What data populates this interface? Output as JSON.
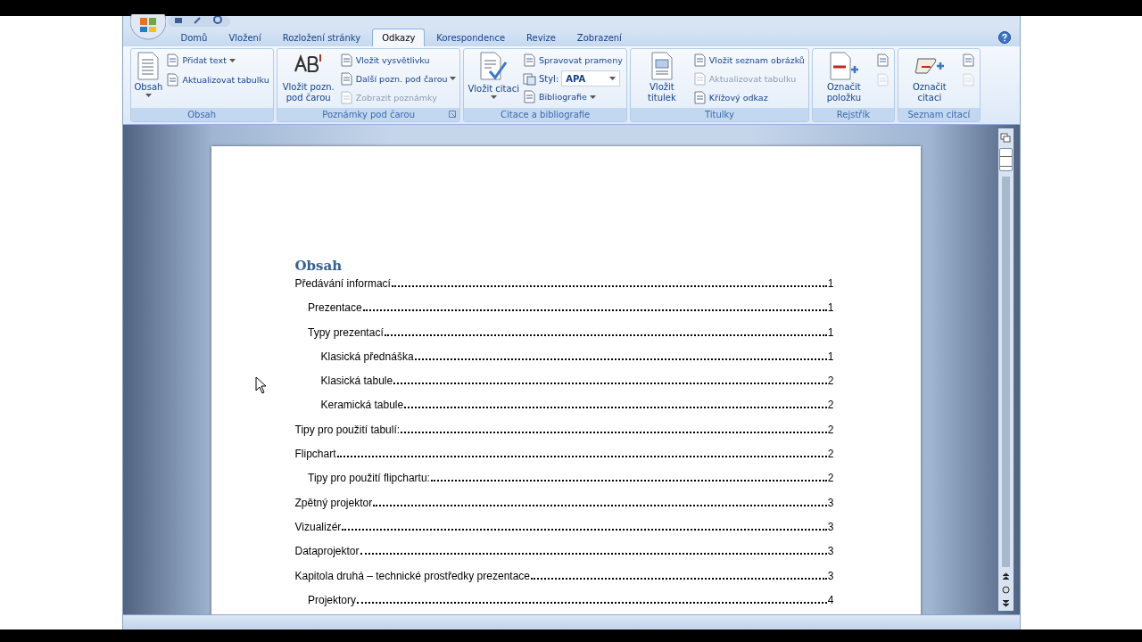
{
  "tabs": [
    {
      "label": "Domů",
      "selected": false
    },
    {
      "label": "Vložení",
      "selected": false
    },
    {
      "label": "Rozložení stránky",
      "selected": false
    },
    {
      "label": "Odkazy",
      "selected": true
    },
    {
      "label": "Korespondence",
      "selected": false
    },
    {
      "label": "Revize",
      "selected": false
    },
    {
      "label": "Zobrazení",
      "selected": false
    }
  ],
  "ribbon_groups": [
    {
      "label": "Obsah",
      "launcher": false,
      "items": [
        {
          "kind": "large",
          "label": "Obsah",
          "dropdown": true,
          "disabled": false
        },
        {
          "kind": "small",
          "label": "Přidat text",
          "dropdown": true,
          "disabled": false
        },
        {
          "kind": "small",
          "label": "Aktualizovat tabulku",
          "dropdown": false,
          "disabled": false
        }
      ]
    },
    {
      "label": "Poznámky pod čarou",
      "launcher": true,
      "items": [
        {
          "kind": "large",
          "label": "Vložit pozn. pod čarou",
          "dropdown": false,
          "disabled": false
        },
        {
          "kind": "small",
          "label": "Vložit vysvětlivku",
          "dropdown": false,
          "disabled": false
        },
        {
          "kind": "small",
          "label": "Další pozn. pod čarou",
          "dropdown": true,
          "disabled": false
        },
        {
          "kind": "small",
          "label": "Zobrazit poznámky",
          "dropdown": false,
          "disabled": true
        }
      ]
    },
    {
      "label": "Citace a bibliografie",
      "launcher": false,
      "items": [
        {
          "kind": "large",
          "label": "Vložit citaci",
          "dropdown": true,
          "disabled": false
        },
        {
          "kind": "small",
          "label": "Spravovat prameny",
          "dropdown": false,
          "disabled": false
        },
        {
          "kind": "combo",
          "label": "Styl:",
          "value": "APA",
          "dropdown": true,
          "disabled": false
        },
        {
          "kind": "small",
          "label": "Bibliografie",
          "dropdown": true,
          "disabled": false
        }
      ]
    },
    {
      "label": "Titulky",
      "launcher": false,
      "items": [
        {
          "kind": "large",
          "label": "Vložit titulek",
          "dropdown": false,
          "disabled": false
        },
        {
          "kind": "small",
          "label": "Vložit seznam obrázků",
          "dropdown": false,
          "disabled": false
        },
        {
          "kind": "small",
          "label": "Aktualizovat tabulku",
          "dropdown": false,
          "disabled": true
        },
        {
          "kind": "small",
          "label": "Křížový odkaz",
          "dropdown": false,
          "disabled": false
        }
      ]
    },
    {
      "label": "Rejstřík",
      "launcher": false,
      "items": [
        {
          "kind": "large",
          "label": "Označit položku",
          "dropdown": false,
          "disabled": false
        },
        {
          "kind": "icon",
          "disabled": false
        },
        {
          "kind": "icon",
          "disabled": true
        }
      ]
    },
    {
      "label": "Seznam citací",
      "launcher": false,
      "items": [
        {
          "kind": "large",
          "label": "Označit citaci",
          "dropdown": false,
          "disabled": false
        },
        {
          "kind": "icon",
          "disabled": false
        },
        {
          "kind": "icon",
          "disabled": true
        }
      ]
    }
  ],
  "document": {
    "toc_title": "Obsah",
    "entries": [
      {
        "text": "Předávání informací",
        "page": "1",
        "children": [
          {
            "text": "Prezentace",
            "page": "1"
          },
          {
            "text": "Typy prezentací",
            "page": "1",
            "children": [
              {
                "text": "Klasická přednáška",
                "page": "1"
              },
              {
                "text": "Klasická tabule",
                "page": "2"
              },
              {
                "text": "Keramická tabule",
                "page": "2"
              }
            ]
          }
        ]
      },
      {
        "text": "Tipy pro použití tabulí:",
        "page": "2"
      },
      {
        "text": "Flipchart",
        "page": "2",
        "children": [
          {
            "text": "Tipy pro použití flipchartu:",
            "page": "2"
          }
        ]
      },
      {
        "text": "Zpětný projektor",
        "page": "3"
      },
      {
        "text": "Vizualizér",
        "page": "3"
      },
      {
        "text": "Dataprojektor",
        "page": "3"
      },
      {
        "text": "Kapitola druhá – technické prostředky prezentace",
        "page": "3",
        "children": [
          {
            "text": "Projektory",
            "page": "4"
          }
        ]
      }
    ]
  }
}
